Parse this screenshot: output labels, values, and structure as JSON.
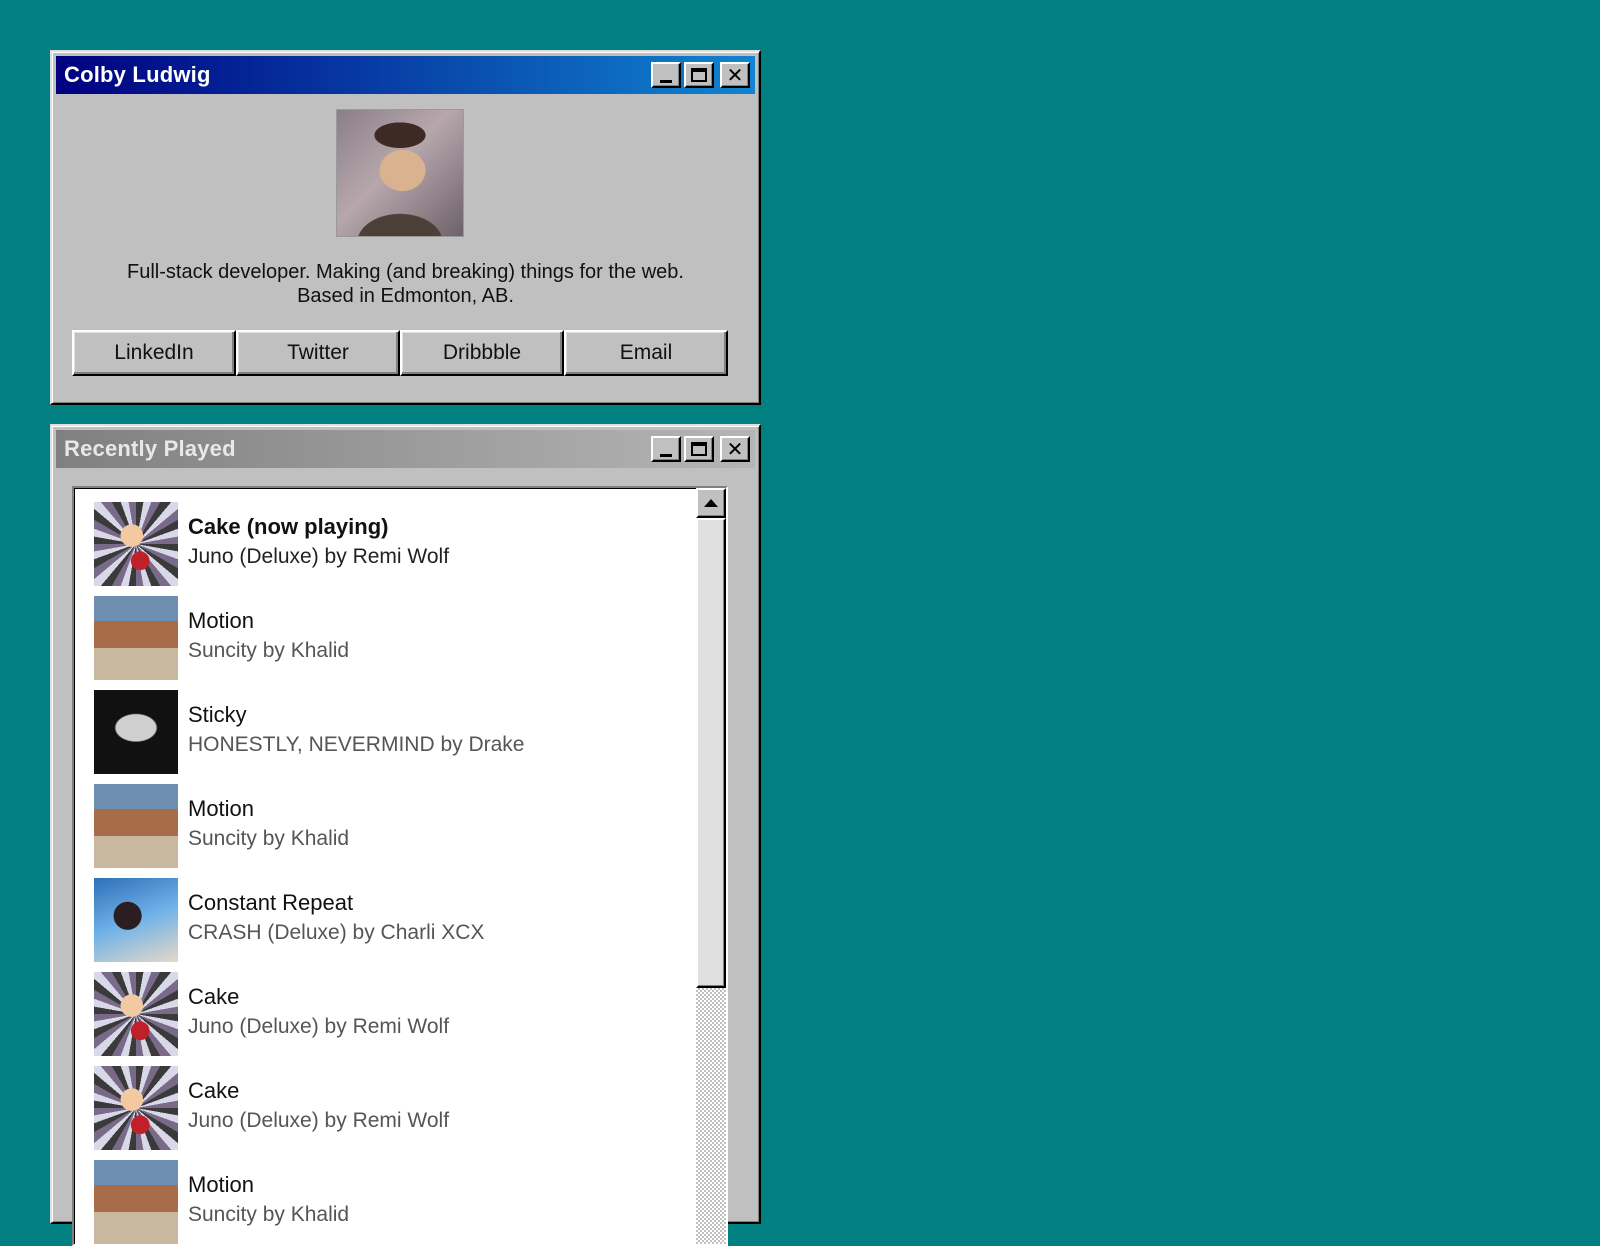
{
  "profile_window": {
    "title": "Colby Ludwig",
    "bio_line1": "Full-stack developer. Making (and breaking) things for the web.",
    "bio_line2": "Based in Edmonton, AB.",
    "links": [
      "LinkedIn",
      "Twitter",
      "Dribbble",
      "Email"
    ]
  },
  "recent_window": {
    "title": "Recently Played",
    "tracks": [
      {
        "title": "Cake (now playing)",
        "subtitle": "Juno (Deluxe) by Remi Wolf",
        "art": "remi-wolf-juno-cover"
      },
      {
        "title": "Motion",
        "subtitle": "Suncity by Khalid",
        "art": "khalid-suncity-cover"
      },
      {
        "title": "Sticky",
        "subtitle": "HONESTLY, NEVERMIND by Drake",
        "art": "drake-honestly-nevermind-cover"
      },
      {
        "title": "Motion",
        "subtitle": "Suncity by Khalid",
        "art": "khalid-suncity-cover"
      },
      {
        "title": "Constant Repeat",
        "subtitle": "CRASH (Deluxe) by Charli XCX",
        "art": "charli-xcx-crash-cover"
      },
      {
        "title": "Cake",
        "subtitle": "Juno (Deluxe) by Remi Wolf",
        "art": "remi-wolf-juno-cover"
      },
      {
        "title": "Cake",
        "subtitle": "Juno (Deluxe) by Remi Wolf",
        "art": "remi-wolf-juno-cover"
      },
      {
        "title": "Motion",
        "subtitle": "Suncity by Khalid",
        "art": "khalid-suncity-cover"
      }
    ]
  },
  "colors": {
    "desktop": "#008080",
    "window": "#c0c0c0",
    "active_title_start": "#000080",
    "active_title_end": "#1084d0",
    "inactive_title": "#808080"
  }
}
